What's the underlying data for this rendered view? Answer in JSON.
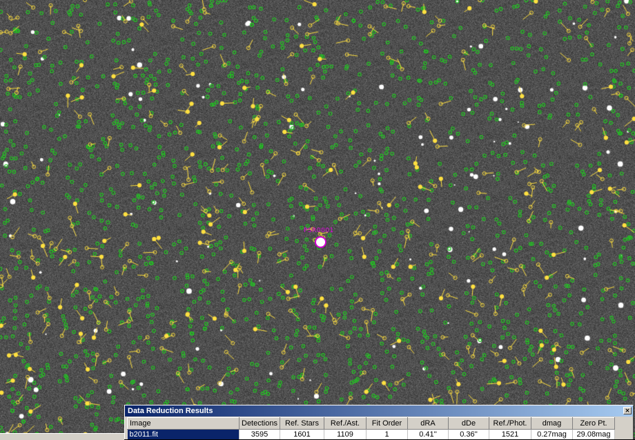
{
  "target": {
    "label": "PSR0001"
  },
  "results": {
    "title": "Data Reduction Results",
    "close_glyph": "×",
    "columns": [
      "Image",
      "Detections",
      "Ref. Stars",
      "Ref./Ast.",
      "Fit Order",
      "dRA",
      "dDe",
      "Ref./Phot.",
      "dmag",
      "Zero Pt."
    ],
    "row": [
      "b2011.fit",
      "3595",
      "1601",
      "1109",
      "1",
      "0.41''",
      "0.36''",
      "1521",
      "0.27mag",
      "29.08mag"
    ]
  },
  "colors": {
    "reference_star_marker": "#22c422",
    "astrometric_marker": "#ffe040",
    "target_marker": "#e000e0",
    "titlebar": "#0a246a"
  }
}
